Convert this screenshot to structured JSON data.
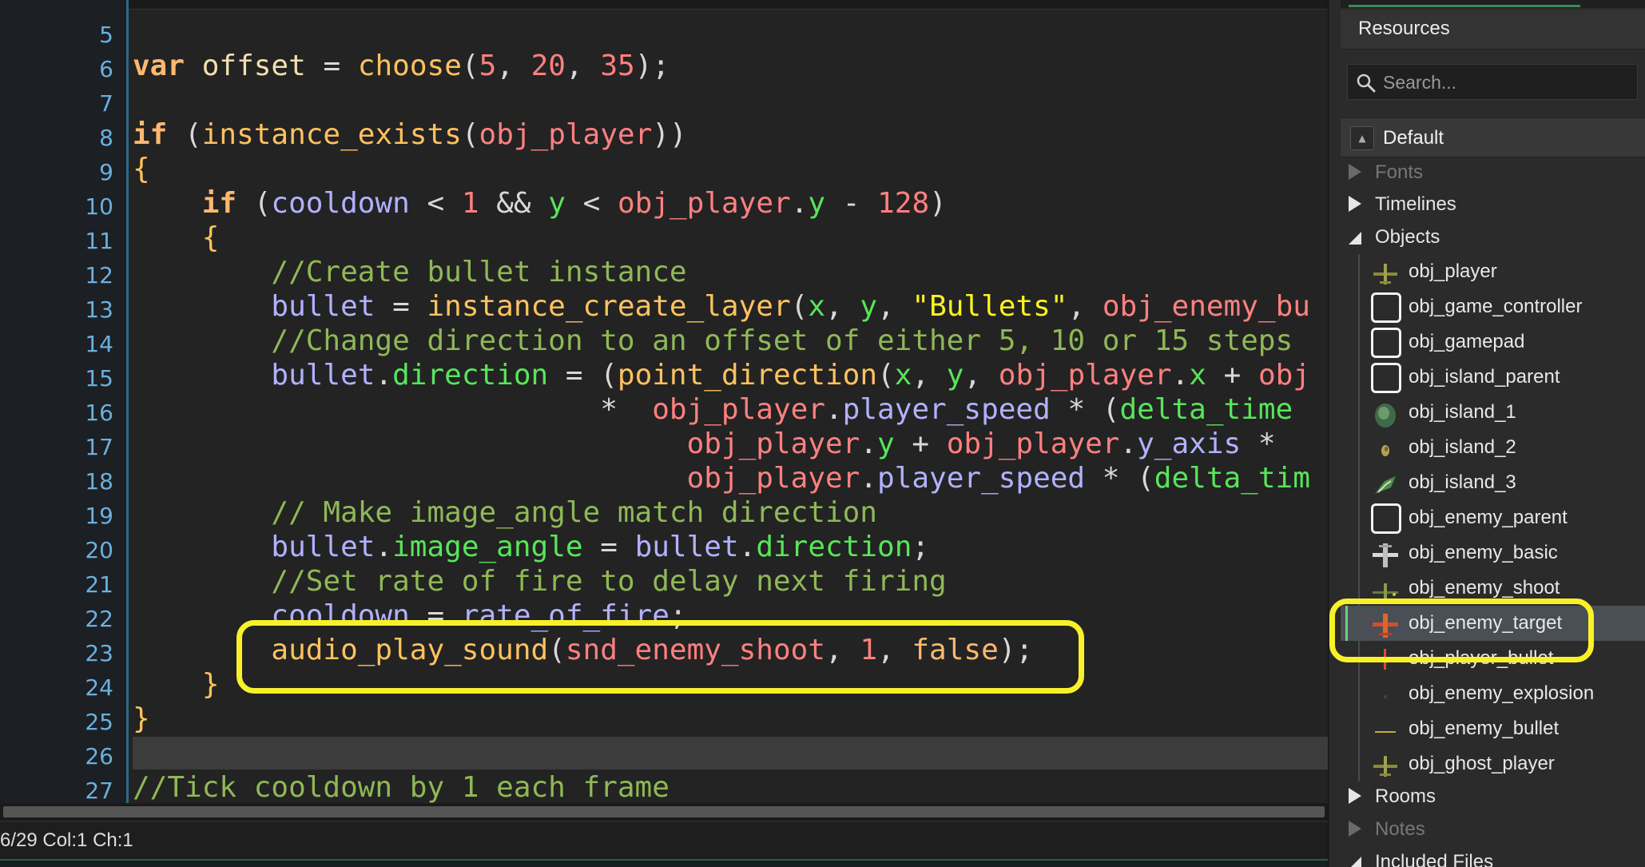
{
  "editor": {
    "line_numbers": [
      "5",
      "6",
      "7",
      "8",
      "9",
      "10",
      "11",
      "12",
      "13",
      "14",
      "15",
      "16",
      "17",
      "18",
      "19",
      "20",
      "21",
      "22",
      "23",
      "24",
      "25",
      "26",
      "27"
    ],
    "code": {
      "l6": [
        "var",
        "offset",
        "=",
        "choose",
        "(",
        "5",
        ", ",
        "20",
        ", ",
        "35",
        ");"
      ],
      "l8": [
        "if",
        " (",
        "instance_exists",
        "(",
        "obj_player",
        "))"
      ],
      "l9": "{",
      "l10": [
        "if",
        " (",
        "cooldown",
        " < ",
        "1",
        " && ",
        "y",
        " < ",
        "obj_player",
        ".",
        "y",
        " - ",
        "128",
        ")"
      ],
      "l11": "{",
      "l12": "//Create bullet instance",
      "l13": [
        "bullet",
        " = ",
        "instance_create_layer",
        "(",
        "x",
        ", ",
        "y",
        ", ",
        "\"Bullets\"",
        ", ",
        "obj_enemy_bu"
      ],
      "l14": "//Change direction to an offset of either 5, 10 or 15 steps",
      "l15": [
        "bullet",
        ".",
        "direction",
        " = (",
        "point_direction",
        "(",
        "x",
        ", ",
        "y",
        ", ",
        "obj_player",
        ".",
        "x",
        " + ",
        "obj"
      ],
      "l16": [
        "*  ",
        "obj_player",
        ".",
        "player_speed",
        " * (",
        "delta_time"
      ],
      "l17": [
        "obj_player",
        ".",
        "y",
        " + ",
        "obj_player",
        ".",
        "y_axis",
        " *"
      ],
      "l18": [
        "obj_player",
        ".",
        "player_speed",
        " * (",
        "delta_tim"
      ],
      "l19": "// Make image_angle match direction",
      "l20": [
        "bullet",
        ".",
        "image_angle",
        " = ",
        "bullet",
        ".",
        "direction",
        ";"
      ],
      "l21": "//Set rate of fire to delay next firing",
      "l22": [
        "cooldown",
        " = ",
        "rate_of_fire",
        ";"
      ],
      "l23": [
        "audio_play_sound",
        "(",
        "snd_enemy_shoot",
        ", ",
        "1",
        ", ",
        "false",
        ");"
      ],
      "l24": "}",
      "l25": "}",
      "l27": "//Tick cooldown by 1 each frame"
    },
    "status": "6/29 Col:1 Ch:1"
  },
  "resources": {
    "title": "Resources",
    "search_placeholder": "Search...",
    "group": "Default",
    "folders": {
      "fonts": "Fonts",
      "timelines": "Timelines",
      "objects": "Objects",
      "rooms": "Rooms",
      "notes": "Notes",
      "included_files": "Included Files"
    },
    "objects": [
      {
        "name": "obj_player",
        "icon": "plane-sprite-icon"
      },
      {
        "name": "obj_game_controller",
        "icon": "blank-sprite-icon"
      },
      {
        "name": "obj_gamepad",
        "icon": "blank-sprite-icon"
      },
      {
        "name": "obj_island_parent",
        "icon": "blank-sprite-icon"
      },
      {
        "name": "obj_island_1",
        "icon": "island-sprite-icon"
      },
      {
        "name": "obj_island_2",
        "icon": "island-sprite-icon"
      },
      {
        "name": "obj_island_3",
        "icon": "island-sprite-icon"
      },
      {
        "name": "obj_enemy_parent",
        "icon": "blank-sprite-icon"
      },
      {
        "name": "obj_enemy_basic",
        "icon": "plane-sprite-icon"
      },
      {
        "name": "obj_enemy_shoot",
        "icon": "plane-sprite-icon"
      },
      {
        "name": "obj_enemy_target",
        "icon": "plane-sprite-icon"
      },
      {
        "name": "obj_player_bullet",
        "icon": "bullet-sprite-icon"
      },
      {
        "name": "obj_enemy_explosion",
        "icon": "explosion-sprite-icon"
      },
      {
        "name": "obj_enemy_bullet",
        "icon": "bullet-sprite-icon"
      },
      {
        "name": "obj_ghost_player",
        "icon": "plane-sprite-icon"
      }
    ],
    "selected_object": "obj_enemy_target"
  },
  "colors": {
    "highlight_callout": "#f8f12a",
    "keyword": "#ffb871",
    "comment": "#8fb857",
    "string": "#fcf320",
    "number": "#ff8080"
  }
}
